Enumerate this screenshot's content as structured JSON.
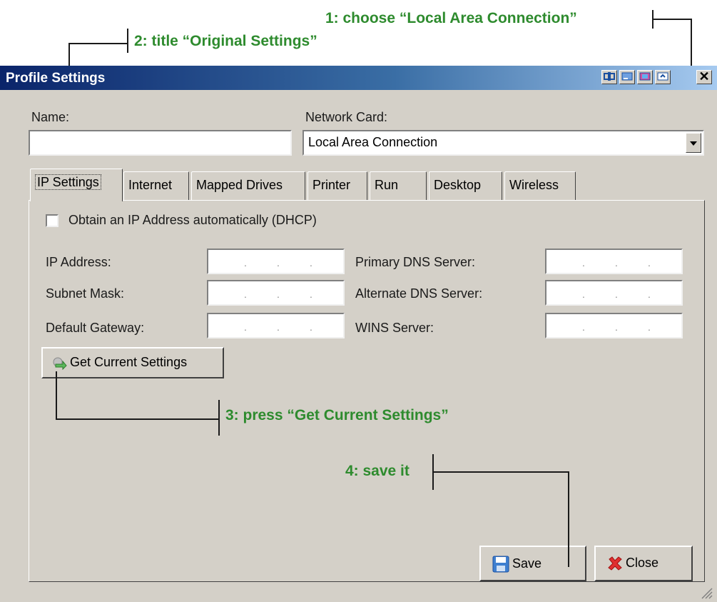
{
  "annotations": {
    "step1": "1: choose “Local Area Connection”",
    "step2": "2: title “Original Settings”",
    "step3": "3: press “Get Current Settings”",
    "step4": "4: save it"
  },
  "window": {
    "title": "Profile Settings",
    "titlebar_buttons": [
      "pin-icon",
      "minimize-to-tray-icon",
      "color-icon",
      "maximize-icon",
      "close-icon"
    ],
    "close_glyph": "✕"
  },
  "form": {
    "name_label": "Name:",
    "name_value": "",
    "network_card_label": "Network Card:",
    "network_card_value": "Local Area Connection"
  },
  "tabs": [
    {
      "label": "IP Settings",
      "active": true
    },
    {
      "label": "Internet"
    },
    {
      "label": "Mapped Drives"
    },
    {
      "label": "Printer"
    },
    {
      "label": "Run"
    },
    {
      "label": "Desktop"
    },
    {
      "label": "Wireless"
    }
  ],
  "ip_settings": {
    "dhcp_label": "Obtain an IP Address automatically (DHCP)",
    "dhcp_checked": false,
    "ip_address_label": "IP Address:",
    "subnet_mask_label": "Subnet Mask:",
    "default_gateway_label": "Default Gateway:",
    "primary_dns_label": "Primary DNS Server:",
    "alternate_dns_label": "Alternate DNS Server:",
    "wins_label": "WINS Server:",
    "ip_dot": ".",
    "get_current_label": "Get Current Settings"
  },
  "footer": {
    "save_label": "Save",
    "close_label": "Close"
  },
  "colors": {
    "annotation": "#2e8b2e",
    "title_gradient_start": "#0a246a",
    "title_gradient_end": "#a6caf0",
    "window_face": "#d4d0c8"
  }
}
